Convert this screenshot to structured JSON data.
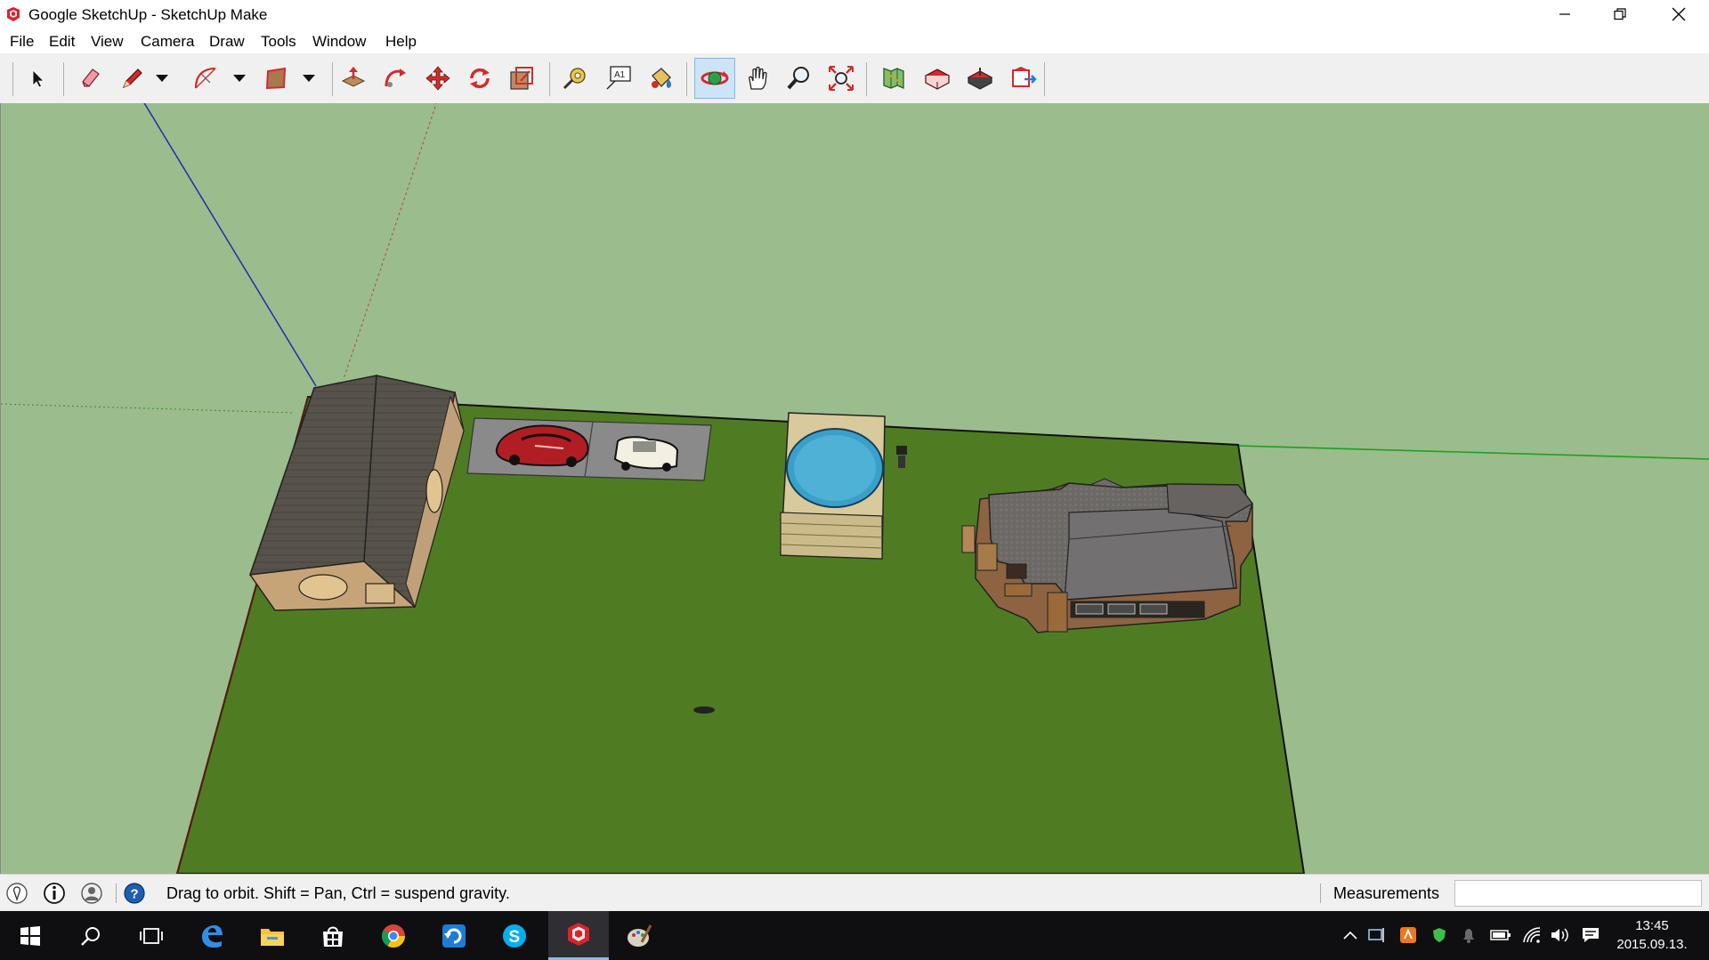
{
  "window": {
    "title": "Google SketchUp - SketchUp Make",
    "controls": [
      "minimize-icon",
      "restore-icon",
      "close-icon"
    ]
  },
  "menu": [
    "File",
    "Edit",
    "View",
    "Camera",
    "Draw",
    "Tools",
    "Window",
    "Help"
  ],
  "toolbar": {
    "tools": [
      {
        "name": "select-icon"
      },
      {
        "name": "eraser-icon"
      },
      {
        "name": "pencil-line-icon"
      },
      {
        "name": "dropdown-arrow-icon"
      },
      {
        "name": "arc-icon"
      },
      {
        "name": "dropdown-arrow-icon"
      },
      {
        "name": "rectangle-icon"
      },
      {
        "name": "dropdown-arrow-icon"
      },
      {
        "name": "push-pull-icon"
      },
      {
        "name": "follow-me-icon"
      },
      {
        "name": "move-icon"
      },
      {
        "name": "rotate-icon"
      },
      {
        "name": "scale-icon"
      },
      {
        "name": "tape-measure-icon"
      },
      {
        "name": "text-icon"
      },
      {
        "name": "paint-bucket-icon"
      },
      {
        "name": "orbit-icon",
        "active": true
      },
      {
        "name": "pan-icon"
      },
      {
        "name": "zoom-icon"
      },
      {
        "name": "zoom-extents-icon"
      },
      {
        "name": "add-location-icon"
      },
      {
        "name": "3d-warehouse-icon"
      },
      {
        "name": "share-model-icon"
      },
      {
        "name": "extension-warehouse-icon"
      }
    ],
    "text_tool_label": "A1"
  },
  "status": {
    "hint": "Drag to orbit. Shift = Pan, Ctrl = suspend gravity.",
    "measurements_label": "Measurements",
    "measurements_value": ""
  },
  "taskbar": {
    "apps": [
      "windows-start-icon",
      "search-icon",
      "task-view-icon",
      "edge-icon",
      "file-explorer-icon",
      "store-icon",
      "chrome-icon",
      "refresh-app-icon",
      "skype-icon",
      "sketchup-icon",
      "paint-icon"
    ],
    "active_app": "sketchup-icon",
    "skype_letter": "S",
    "store_letter": "⊞",
    "time": "13:45",
    "date": "2015.09.13."
  },
  "colors": {
    "sky": "#9bbc8d",
    "ground": "#4f7c23",
    "roof": "#555149",
    "accent_blue": "#1e7bd6",
    "sketchup_red": "#d7242b"
  }
}
